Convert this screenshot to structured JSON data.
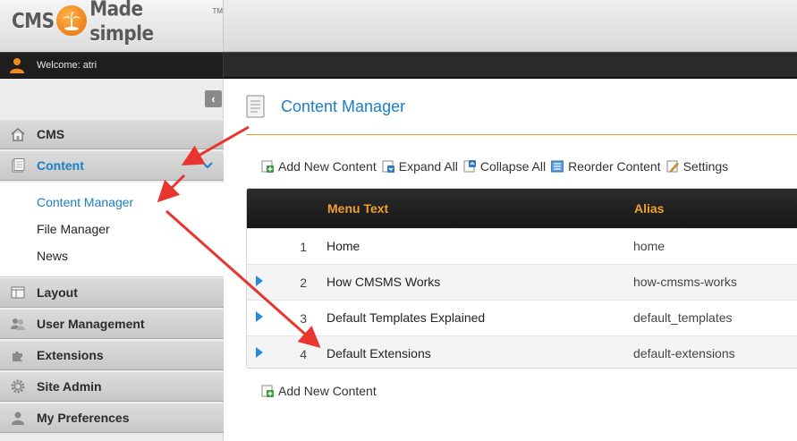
{
  "header": {
    "logo": {
      "left": "CMS",
      "right": "Made simple",
      "tm": "TM"
    },
    "welcome_text": "Welcome: atri"
  },
  "sidebar": {
    "collapse_icon": "chevron-left-icon",
    "items": [
      {
        "label": "CMS",
        "icon": "home-icon"
      },
      {
        "label": "Content",
        "icon": "document-icon",
        "active": true
      },
      {
        "label": "Layout",
        "icon": "layout-icon"
      },
      {
        "label": "User Management",
        "icon": "users-icon"
      },
      {
        "label": "Extensions",
        "icon": "puzzle-icon"
      },
      {
        "label": "Site Admin",
        "icon": "gear-icon"
      },
      {
        "label": "My Preferences",
        "icon": "user-icon"
      }
    ],
    "content_subitems": [
      {
        "label": "Content Manager",
        "active": true
      },
      {
        "label": "File Manager"
      },
      {
        "label": "News"
      }
    ]
  },
  "main": {
    "page_title": "Content Manager",
    "toolbar": {
      "add_new_content": "Add New Content",
      "expand_all": "Expand All",
      "collapse_all": "Collapse All",
      "reorder_content": "Reorder Content",
      "settings": "Settings"
    },
    "table": {
      "columns": [
        "Menu Text",
        "Alias"
      ],
      "rows": [
        {
          "num": "1",
          "menu_text": "Home",
          "alias": "home",
          "expandable": false
        },
        {
          "num": "2",
          "menu_text": "How CMSMS Works",
          "alias": "how-cmsms-works",
          "expandable": true
        },
        {
          "num": "3",
          "menu_text": "Default Templates Explained",
          "alias": "default_templates",
          "expandable": true
        },
        {
          "num": "4",
          "menu_text": "Default Extensions",
          "alias": "default-extensions",
          "expandable": true
        }
      ]
    },
    "bottom_add_label": "Add New Content"
  },
  "colors": {
    "accent_blue": "#1a7fc6",
    "header_orange": "#f0a030",
    "annotation_red": "#e8362e"
  }
}
